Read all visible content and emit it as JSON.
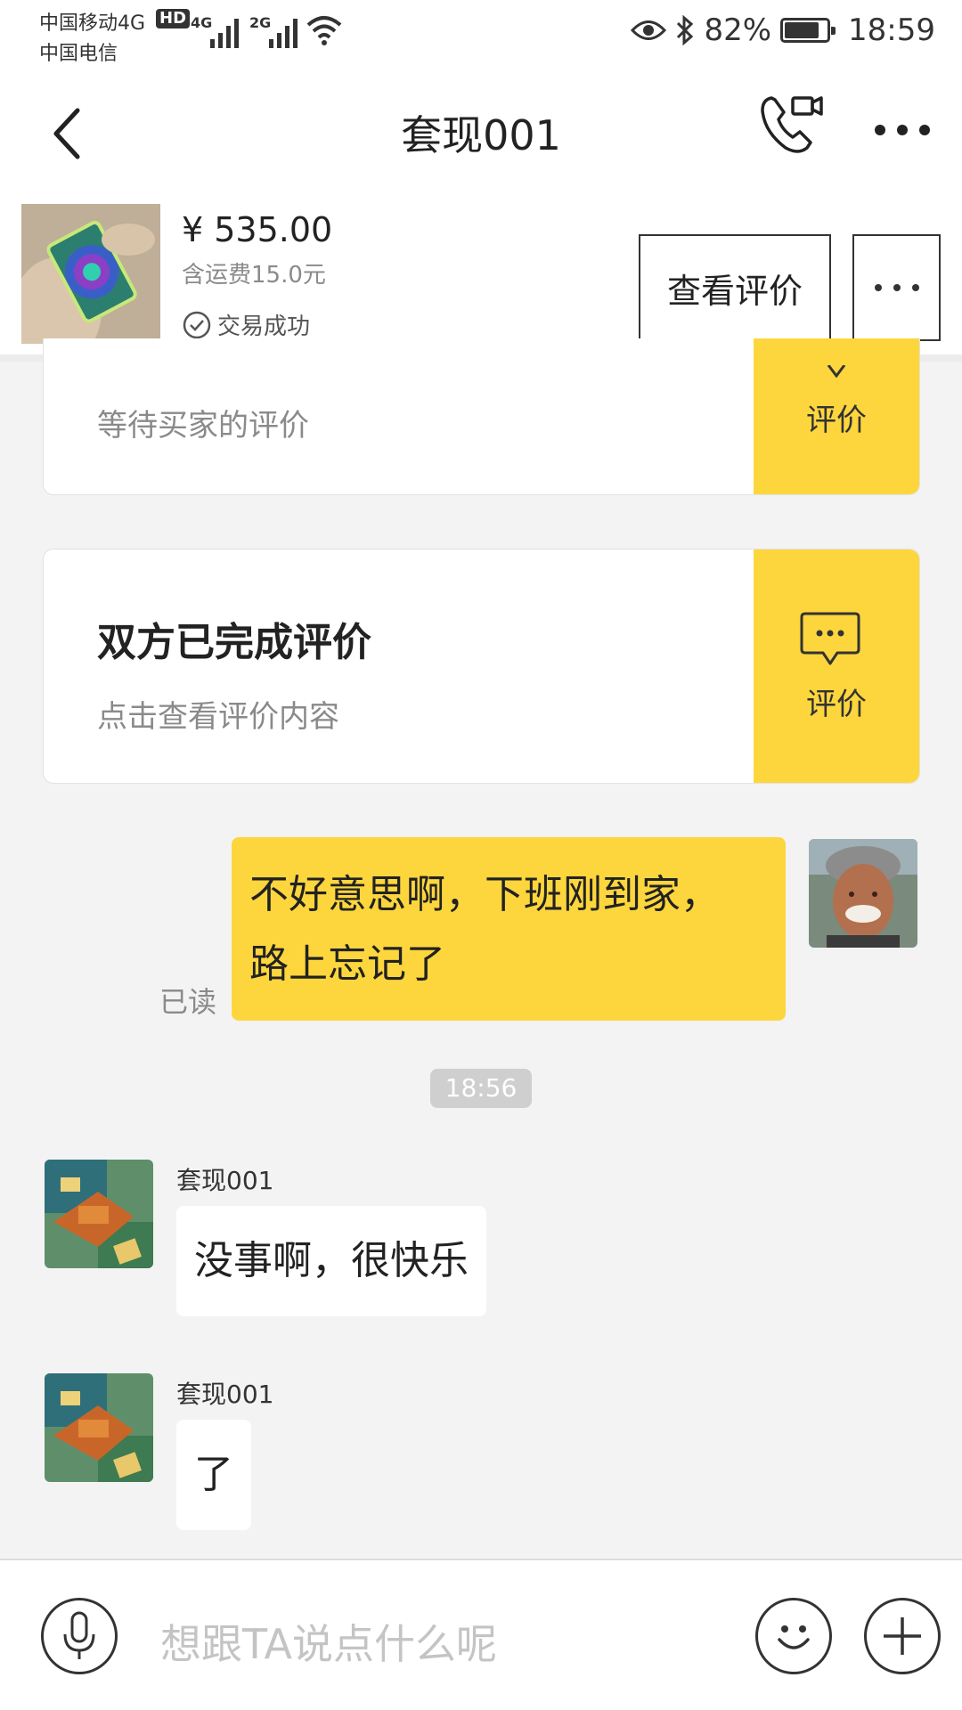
{
  "status_bar": {
    "carrier_primary": "中国移动4G",
    "hd_badge": "HD",
    "carrier_secondary": "中国电信",
    "sim1_network": "4G",
    "sim2_network": "2G",
    "battery_percent": "82%",
    "battery_level": 0.82,
    "time": "18:59",
    "icons": [
      "eye-icon",
      "bluetooth-icon",
      "wifi-icon",
      "signal-icon",
      "battery-icon"
    ]
  },
  "nav": {
    "title": "套现001",
    "icons": [
      "back-icon",
      "video-call-icon",
      "more-icon"
    ]
  },
  "product": {
    "price": "¥ 535.00",
    "shipping": "含运费15.0元",
    "status": "交易成功",
    "review_button": "查看评价"
  },
  "cards": [
    {
      "title": "",
      "subtitle": "等待买家的评价",
      "side_label": "评价"
    },
    {
      "title": "双方已完成评价",
      "subtitle": "点击查看评价内容",
      "side_label": "评价",
      "side_icon": "chat-bubble-icon"
    }
  ],
  "chat": {
    "outgoing": {
      "lines": [
        "不好意思啊，下班刚到家，",
        "路上忘记了"
      ],
      "read_status": "已读"
    },
    "timestamp": "18:56",
    "incoming": [
      {
        "sender": "套现001",
        "text": "没事啊，很快乐"
      },
      {
        "sender": "套现001",
        "text": "了"
      }
    ]
  },
  "input_bar": {
    "placeholder": "想跟TA说点什么呢",
    "icons": [
      "microphone-icon",
      "emoji-icon",
      "plus-icon"
    ]
  },
  "colors": {
    "accent_yellow": "#fdd63d",
    "background": "#f3f3f4",
    "time_pill": "#cfcfcf"
  }
}
